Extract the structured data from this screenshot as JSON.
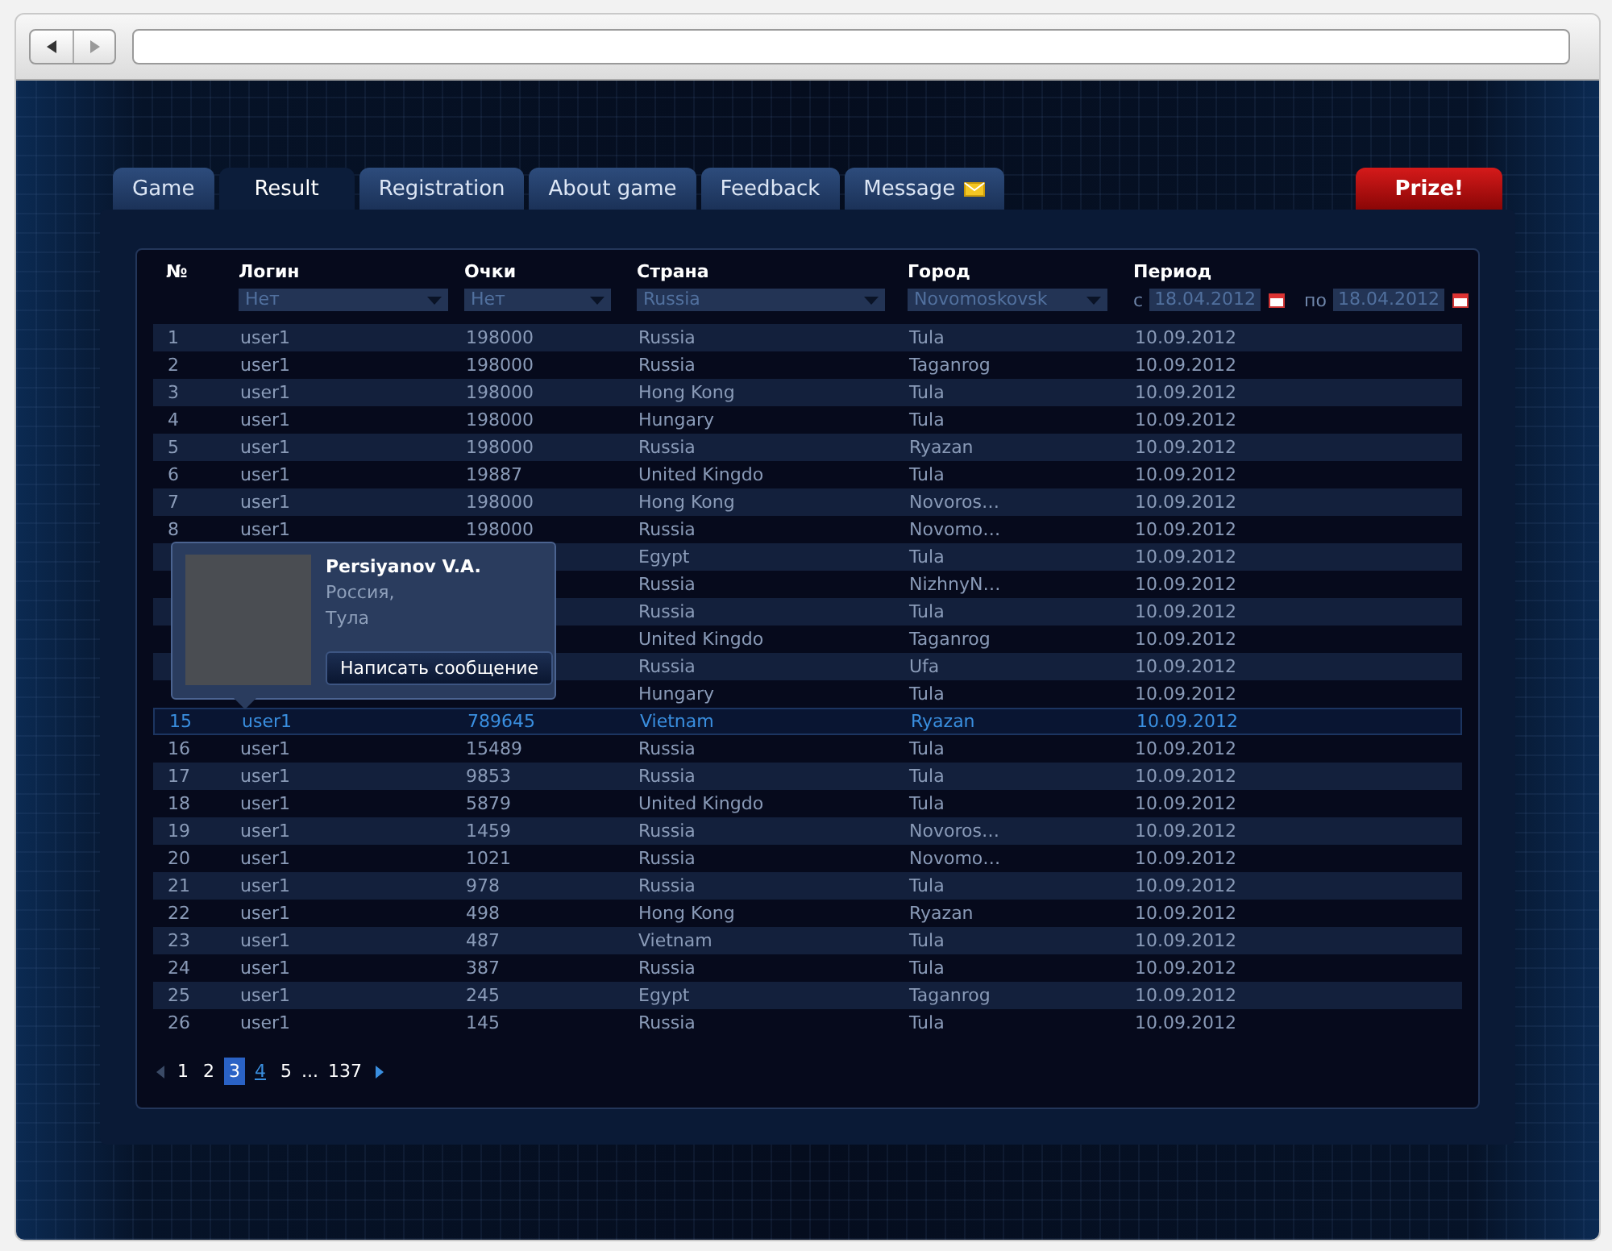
{
  "tabs": [
    {
      "label": "Game",
      "kind": "plain",
      "selected": false
    },
    {
      "label": "Result",
      "kind": "plain",
      "selected": true
    },
    {
      "label": "Registration",
      "kind": "plain",
      "selected": false
    },
    {
      "label": "About game",
      "kind": "plain",
      "selected": false
    },
    {
      "label": "Feedback",
      "kind": "plain",
      "selected": false
    },
    {
      "label": "Message",
      "kind": "message",
      "selected": false
    }
  ],
  "prize_button": "Prize!",
  "table": {
    "columns": [
      "№",
      "Логин",
      "Очки",
      "Страна",
      "Город",
      "Период"
    ],
    "filters": {
      "login": "Нет",
      "score": "Нет",
      "country": "Russia",
      "city": "Novomoskovsk",
      "period_from_label": "с",
      "period_from": "18.04.2012",
      "period_to_label": "по",
      "period_to": "18.04.2012"
    },
    "rows": [
      {
        "number": "1",
        "login": "user1",
        "score": "198000",
        "country": "Russia",
        "city": "Tula",
        "date": "10.09.2012",
        "selected": false
      },
      {
        "number": "2",
        "login": "user1",
        "score": "198000",
        "country": "Russia",
        "city": "Taganrog",
        "date": "10.09.2012",
        "selected": false
      },
      {
        "number": "3",
        "login": "user1",
        "score": "198000",
        "country": "Hong Kong",
        "city": "Tula",
        "date": "10.09.2012",
        "selected": false
      },
      {
        "number": "4",
        "login": "user1",
        "score": "198000",
        "country": "Hungary",
        "city": "Tula",
        "date": "10.09.2012",
        "selected": false
      },
      {
        "number": "5",
        "login": "user1",
        "score": "198000",
        "country": "Russia",
        "city": "Ryazan",
        "date": "10.09.2012",
        "selected": false
      },
      {
        "number": "6",
        "login": "user1",
        "score": "19887",
        "country": "United Kingdo",
        "city": "Tula",
        "date": "10.09.2012",
        "selected": false
      },
      {
        "number": "7",
        "login": "user1",
        "score": "198000",
        "country": "Hong Kong",
        "city": "Novoros…",
        "date": "10.09.2012",
        "selected": false
      },
      {
        "number": "8",
        "login": "user1",
        "score": "198000",
        "country": "Russia",
        "city": "Novomo…",
        "date": "10.09.2012",
        "selected": false
      },
      {
        "country": "Egypt",
        "city": "Tula",
        "date": "10.09.2012",
        "selected": false
      },
      {
        "country": "Russia",
        "city": "NizhnyN…",
        "date": "10.09.2012",
        "selected": false
      },
      {
        "country": "Russia",
        "city": "Tula",
        "date": "10.09.2012",
        "selected": false
      },
      {
        "country": "United Kingdo",
        "city": "Taganrog",
        "date": "10.09.2012",
        "selected": false
      },
      {
        "country": "Russia",
        "city": "Ufa",
        "date": "10.09.2012",
        "selected": false
      },
      {
        "country": "Hungary",
        "city": "Tula",
        "date": "10.09.2012",
        "selected": false
      },
      {
        "number": "15",
        "login": "user1",
        "score": "789645",
        "country": "Vietnam",
        "city": "Ryazan",
        "date": "10.09.2012",
        "selected": true
      },
      {
        "number": "16",
        "login": "user1",
        "score": "15489",
        "country": "Russia",
        "city": "Tula",
        "date": "10.09.2012",
        "selected": false
      },
      {
        "number": "17",
        "login": "user1",
        "score": "9853",
        "country": "Russia",
        "city": "Tula",
        "date": "10.09.2012",
        "selected": false
      },
      {
        "number": "18",
        "login": "user1",
        "score": "5879",
        "country": "United Kingdo",
        "city": "Tula",
        "date": "10.09.2012",
        "selected": false
      },
      {
        "number": "19",
        "login": "user1",
        "score": "1459",
        "country": "Russia",
        "city": "Novoros…",
        "date": "10.09.2012",
        "selected": false
      },
      {
        "number": "20",
        "login": "user1",
        "score": "1021",
        "country": "Russia",
        "city": "Novomo…",
        "date": "10.09.2012",
        "selected": false
      },
      {
        "number": "21",
        "login": "user1",
        "score": "978",
        "country": "Russia",
        "city": "Tula",
        "date": "10.09.2012",
        "selected": false
      },
      {
        "number": "22",
        "login": "user1",
        "score": "498",
        "country": "Hong Kong",
        "city": "Ryazan",
        "date": "10.09.2012",
        "selected": false
      },
      {
        "number": "23",
        "login": "user1",
        "score": "487",
        "country": "Vietnam",
        "city": "Tula",
        "date": "10.09.2012",
        "selected": false
      },
      {
        "number": "24",
        "login": "user1",
        "score": "387",
        "country": "Russia",
        "city": "Tula",
        "date": "10.09.2012",
        "selected": false
      },
      {
        "number": "25",
        "login": "user1",
        "score": "245",
        "country": "Egypt",
        "city": "Taganrog",
        "date": "10.09.2012",
        "selected": false
      },
      {
        "number": "26",
        "login": "user1",
        "score": "145",
        "country": "Russia",
        "city": "Tula",
        "date": "10.09.2012",
        "selected": false
      }
    ]
  },
  "user_popup": {
    "name": "Persiyanov V.A.",
    "country": "Россия,",
    "city": "Тула",
    "button": "Написать сообщение"
  },
  "pagination": {
    "pages": [
      {
        "label": "1",
        "selected": false,
        "hovered": false
      },
      {
        "label": "2",
        "selected": false,
        "hovered": false
      },
      {
        "label": "3",
        "selected": true,
        "hovered": false
      },
      {
        "label": "4",
        "selected": false,
        "hovered": true
      },
      {
        "label": "5",
        "selected": false,
        "hovered": false
      }
    ],
    "ellipsis": "...",
    "last_page": "137"
  }
}
